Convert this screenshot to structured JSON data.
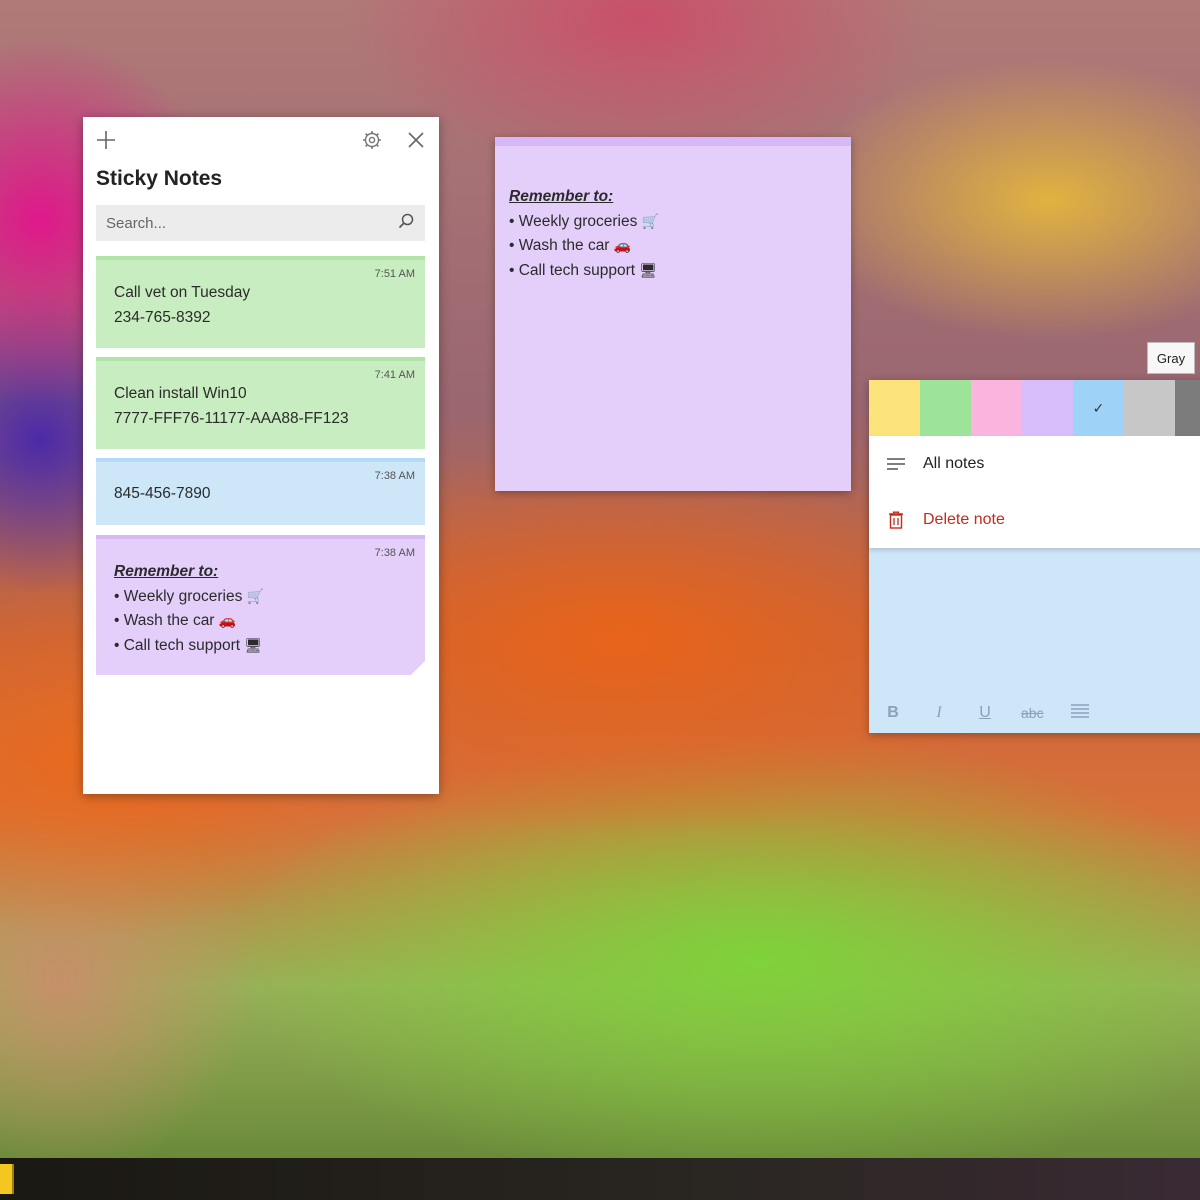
{
  "app": {
    "title": "Sticky Notes",
    "search_placeholder": "Search..."
  },
  "toolbar": {
    "new_note_icon": "plus-icon",
    "settings_icon": "gear-icon",
    "close_icon": "close-icon"
  },
  "notes": [
    {
      "time": "7:51 AM",
      "color": "#c8edc0",
      "stripe": "#b2e3a7",
      "lines": [
        "Call vet on Tuesday",
        "234-765-8392"
      ]
    },
    {
      "time": "7:41 AM",
      "color": "#c8edc0",
      "stripe": "#b2e3a7",
      "lines": [
        "Clean install Win10",
        "7777-FFF76-11177-AAA88-FF123"
      ]
    },
    {
      "time": "7:38 AM",
      "color": "#cde6f8",
      "stripe": "#b5d9f4",
      "lines": [
        "845-456-7890"
      ]
    },
    {
      "time": "7:38 AM",
      "color": "#e3cffa",
      "stripe": "#d6b8f6",
      "heading": "Remember to:",
      "bullets": [
        {
          "text": "Weekly groceries",
          "emoji": "🛒"
        },
        {
          "text": "Wash the car",
          "emoji": "🚗"
        },
        {
          "text": "Call tech support",
          "emoji": "🖥"
        }
      ]
    }
  ],
  "open_note": {
    "color": "#e3cffa",
    "heading": "Remember to:",
    "bullets": [
      {
        "text": "Weekly groceries",
        "emoji": "🛒"
      },
      {
        "text": "Wash the car",
        "emoji": "🚗"
      },
      {
        "text": "Call tech support",
        "emoji": "🖥"
      }
    ]
  },
  "menu": {
    "swatches": [
      {
        "name": "yellow",
        "color": "#fbe27a"
      },
      {
        "name": "green",
        "color": "#9ee39a"
      },
      {
        "name": "pink",
        "color": "#f9b5dd"
      },
      {
        "name": "purple",
        "color": "#d8bdfb"
      },
      {
        "name": "blue",
        "color": "#9ed2f7",
        "selected": true
      },
      {
        "name": "gray",
        "color": "#c7c7c7"
      },
      {
        "name": "charcoal",
        "color": "#7c7c7c"
      }
    ],
    "selected_mark": "✓",
    "tooltip": "Gray",
    "all_notes_label": "All notes",
    "delete_label": "Delete note",
    "delete_color": "#c42b1c"
  },
  "format_toolbar": {
    "bold": "B",
    "italic": "I",
    "underline": "U",
    "strikethrough": "abc",
    "list_icon": "bullet-list-icon"
  }
}
